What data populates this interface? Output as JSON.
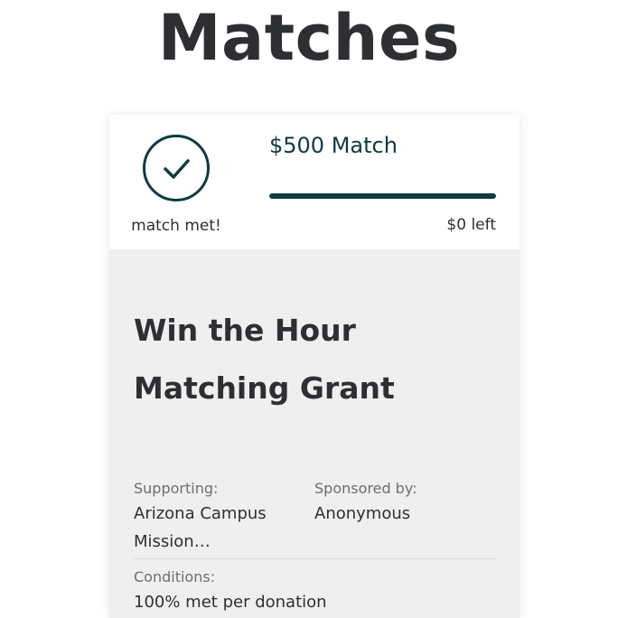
{
  "page": {
    "title": "Matches"
  },
  "match": {
    "amount_label": "$500 Match",
    "status_label": "match met!",
    "remaining_label": "$0 left",
    "progress_fraction": 1.0,
    "accent_color": "#0f3a40",
    "status_icon": "checkmark-circle-icon"
  },
  "grant": {
    "title_line1": "Win the Hour",
    "title_line2": "Matching Grant",
    "supporting_label": "Supporting:",
    "supporting_value_line1": "Arizona Campus",
    "supporting_value_line2": "Mission…",
    "sponsored_label": "Sponsored by:",
    "sponsored_value": "Anonymous",
    "conditions_label": "Conditions:",
    "conditions_value": "100% met per donation"
  }
}
